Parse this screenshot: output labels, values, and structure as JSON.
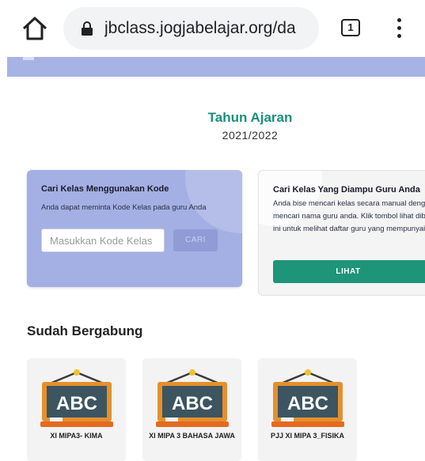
{
  "browser": {
    "url": "jbclass.jogjabelajar.org/da",
    "tab_count": "1"
  },
  "academic_year": {
    "label": "Tahun Ajaran",
    "value": "2021/2022"
  },
  "code_card": {
    "title": "Cari Kelas Menggunakan Kode",
    "description": "Anda dapat meminta Kode Kelas pada guru Anda",
    "input_placeholder": "Masukkan Kode Kelas",
    "button_label": "CARI"
  },
  "teacher_card": {
    "title": "Cari Kelas Yang Diampu Guru Anda",
    "description": "Anda bise mencari kelas secara manual dengan mencari nama guru anda. Klik tombol lihat dibawah ini untuk melihat daftar guru yang mempunyai kelas.",
    "button_label": "LIHAT"
  },
  "joined": {
    "title": "Sudah Bergabung",
    "classes": [
      {
        "name": "XI MIPA3- KIMA",
        "board_text": "ABC"
      },
      {
        "name": "XI MIPA 3 BAHASA JAWA",
        "board_text": "ABC"
      },
      {
        "name": "PJJ XI MIPA 3_FISIKA",
        "board_text": "ABC"
      }
    ]
  },
  "colors": {
    "accent_green": "#1b8f7c",
    "card_blue": "#a4b0e3",
    "button_green": "#1e9479"
  }
}
